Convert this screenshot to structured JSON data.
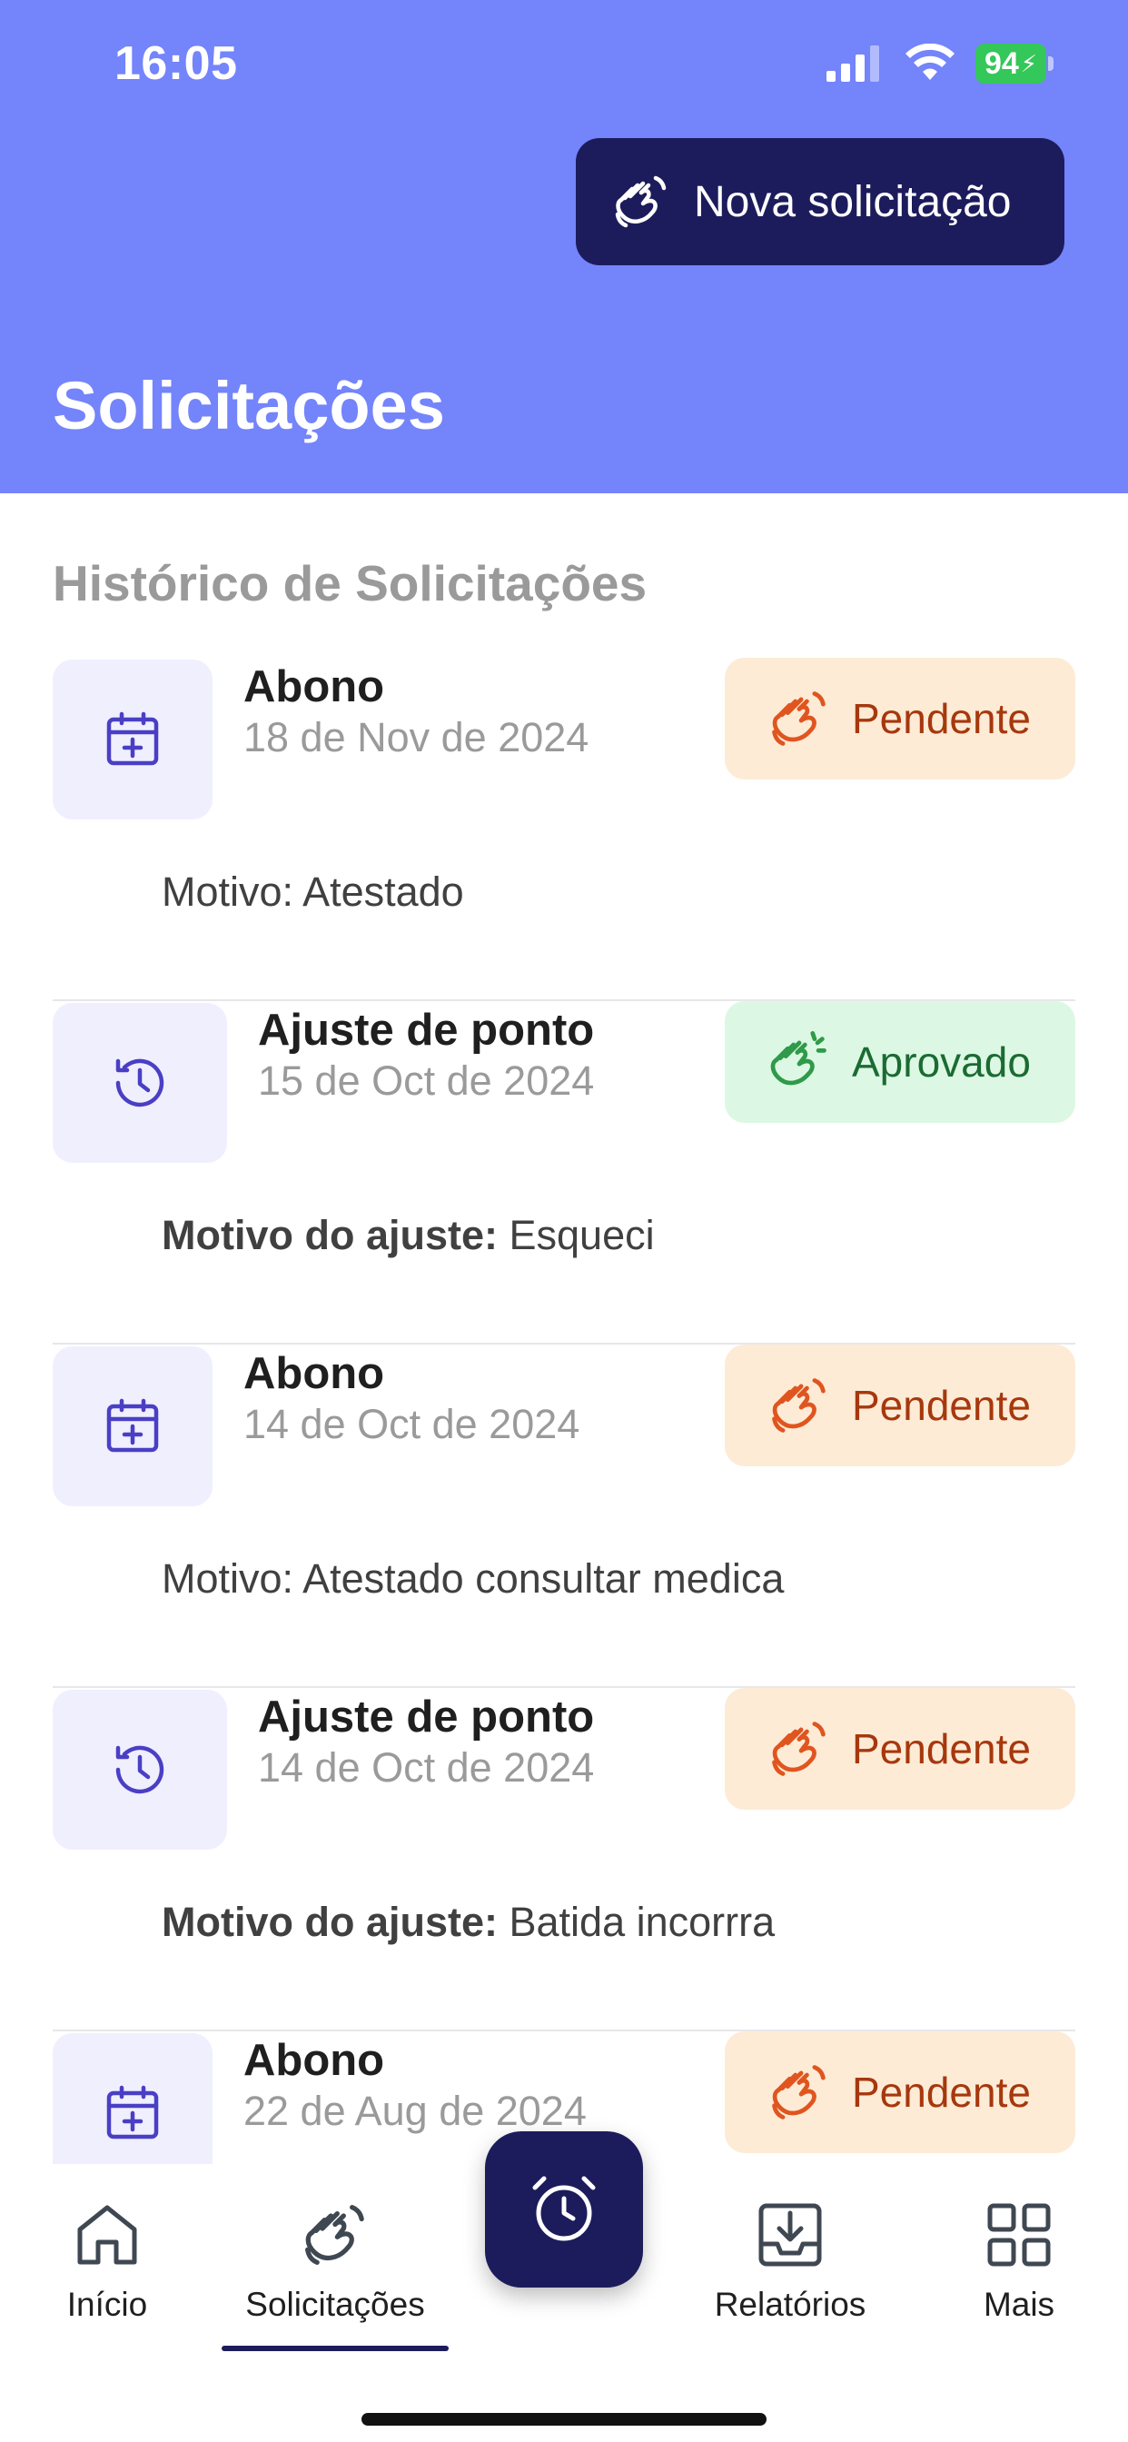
{
  "status_bar": {
    "time": "16:05",
    "battery": "94"
  },
  "header": {
    "new_request_label": "Nova solicitação",
    "title": "Solicitações"
  },
  "section": {
    "title": "Histórico de Solicitações"
  },
  "requests": [
    {
      "type": "Abono",
      "date": "18 de Nov de 2024",
      "status": "Pendente",
      "reason_label": "Motivo: ",
      "reason": "Atestado"
    },
    {
      "type": "Ajuste de ponto",
      "date": "15 de Oct de 2024",
      "status": "Aprovado",
      "reason_label": "Motivo do ajuste: ",
      "reason": "Esqueci"
    },
    {
      "type": "Abono",
      "date": "14 de Oct de 2024",
      "status": "Pendente",
      "reason_label": "Motivo: ",
      "reason": "Atestado consultar medica"
    },
    {
      "type": "Ajuste de ponto",
      "date": "14 de Oct de 2024",
      "status": "Pendente",
      "reason_label": "Motivo do ajuste: ",
      "reason": "Batida incorrra"
    },
    {
      "type": "Abono",
      "date": "22 de Aug de 2024",
      "status": "Pendente"
    }
  ],
  "nav": {
    "inicio": "Início",
    "solicitacoes": "Solicitações",
    "relatorios": "Relatórios",
    "mais": "Mais"
  },
  "colors": {
    "header": "#7484fb",
    "primary_dark": "#1c1c5c",
    "pending_bg": "#fdebd6",
    "pending_fg": "#a6380d",
    "approved_bg": "#dcf8e4",
    "approved_fg": "#1b6b32",
    "accent_icon": "#4a3fc4"
  }
}
